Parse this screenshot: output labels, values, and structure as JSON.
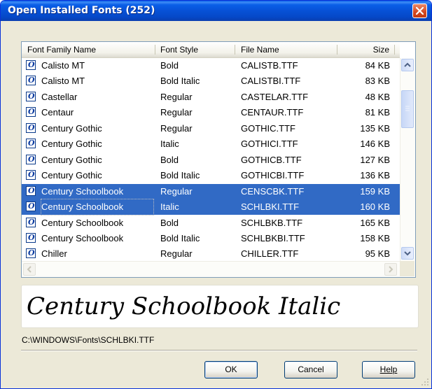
{
  "dialog": {
    "title": "Open Installed Fonts (252)",
    "preview_text": "Century Schoolbook Italic",
    "file_path": "C:\\WINDOWS\\Fonts\\SCHLBKI.TTF",
    "buttons": {
      "ok": "OK",
      "cancel": "Cancel",
      "help": "Help"
    }
  },
  "columns": [
    "Font Family Name",
    "Font Style",
    "File Name",
    "Size"
  ],
  "rows": [
    {
      "family": "Calisto MT",
      "style": "Bold",
      "file": "CALISTB.TTF",
      "size": "84 KB",
      "selected": false
    },
    {
      "family": "Calisto MT",
      "style": "Bold Italic",
      "file": "CALISTBI.TTF",
      "size": "83 KB",
      "selected": false
    },
    {
      "family": "Castellar",
      "style": "Regular",
      "file": "CASTELAR.TTF",
      "size": "48 KB",
      "selected": false
    },
    {
      "family": "Centaur",
      "style": "Regular",
      "file": "CENTAUR.TTF",
      "size": "81 KB",
      "selected": false
    },
    {
      "family": "Century Gothic",
      "style": "Regular",
      "file": "GOTHIC.TTF",
      "size": "135 KB",
      "selected": false
    },
    {
      "family": "Century Gothic",
      "style": "Italic",
      "file": "GOTHICI.TTF",
      "size": "146 KB",
      "selected": false
    },
    {
      "family": "Century Gothic",
      "style": "Bold",
      "file": "GOTHICB.TTF",
      "size": "127 KB",
      "selected": false
    },
    {
      "family": "Century Gothic",
      "style": "Bold Italic",
      "file": "GOTHICBI.TTF",
      "size": "136 KB",
      "selected": false
    },
    {
      "family": "Century Schoolbook",
      "style": "Regular",
      "file": "CENSCBK.TTF",
      "size": "159 KB",
      "selected": true
    },
    {
      "family": "Century Schoolbook",
      "style": "Italic",
      "file": "SCHLBKI.TTF",
      "size": "160 KB",
      "selected": true
    },
    {
      "family": "Century Schoolbook",
      "style": "Bold",
      "file": "SCHLBKB.TTF",
      "size": "165 KB",
      "selected": false
    },
    {
      "family": "Century Schoolbook",
      "style": "Bold Italic",
      "file": "SCHLBKBI.TTF",
      "size": "158 KB",
      "selected": false
    },
    {
      "family": "Chiller",
      "style": "Regular",
      "file": "CHILLER.TTF",
      "size": "95 KB",
      "selected": false
    }
  ],
  "icons": {
    "row_icon": "opentype-font-icon",
    "close": "close-icon"
  },
  "colors": {
    "title_bar": "#0a5fe8",
    "selection": "#316ac5",
    "close_button": "#d5471f"
  }
}
